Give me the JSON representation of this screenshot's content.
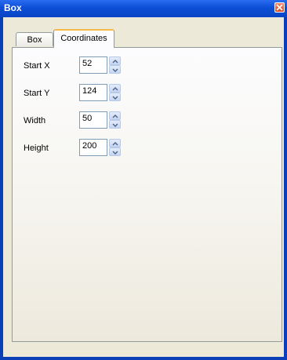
{
  "window": {
    "title": "Box"
  },
  "tabs": [
    {
      "label": "Box"
    },
    {
      "label": "Coordinates",
      "selected": true
    }
  ],
  "fields": [
    {
      "label": "Start X",
      "value": "52"
    },
    {
      "label": "Start Y",
      "value": "124"
    },
    {
      "label": "Width",
      "value": "50"
    },
    {
      "label": "Height",
      "value": "200"
    }
  ],
  "icons": {
    "close": "close-icon",
    "spin_up": "chevron-up-icon",
    "spin_down": "chevron-down-icon"
  },
  "colors": {
    "titlebar": "#0c4fd6",
    "selected_tab_accent": "#f5b94a",
    "close_button": "#d84a23"
  }
}
